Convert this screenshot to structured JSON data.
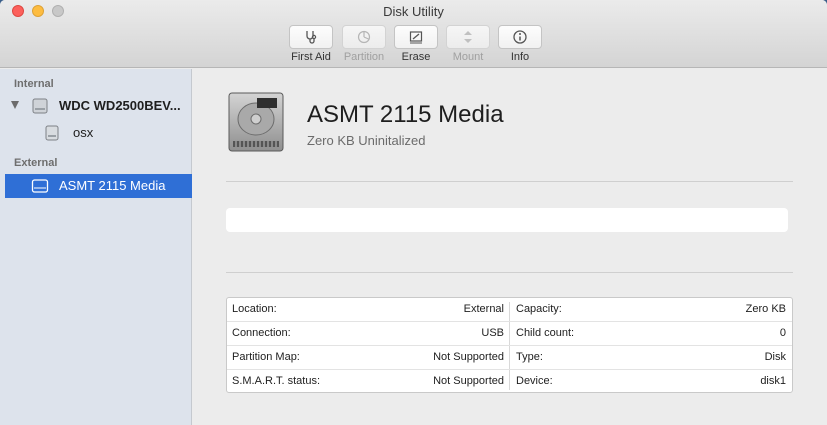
{
  "window": {
    "title": "Disk Utility"
  },
  "toolbar": {
    "items": [
      {
        "label": "First Aid",
        "icon": "stethoscope-icon",
        "enabled": true
      },
      {
        "label": "Partition",
        "icon": "pie-chart-icon",
        "enabled": false
      },
      {
        "label": "Erase",
        "icon": "eraser-icon",
        "enabled": true
      },
      {
        "label": "Mount",
        "icon": "mount-icon",
        "enabled": false
      },
      {
        "label": "Info",
        "icon": "info-icon",
        "enabled": true
      }
    ]
  },
  "sidebar": {
    "sections": [
      {
        "title": "Internal",
        "items": [
          {
            "label": "WDC WD2500BEV...",
            "icon": "hard-drive-icon",
            "expanded": true
          },
          {
            "label": "osx",
            "icon": "volume-icon"
          }
        ]
      },
      {
        "title": "External",
        "items": [
          {
            "label": "ASMT 2115 Media",
            "icon": "external-drive-icon",
            "selected": true
          }
        ]
      }
    ]
  },
  "volume": {
    "name": "ASMT 2115 Media",
    "subtitle": "Zero KB Uninitalized"
  },
  "info": {
    "left": [
      {
        "label": "Location:",
        "value": "External"
      },
      {
        "label": "Connection:",
        "value": "USB"
      },
      {
        "label": "Partition Map:",
        "value": "Not Supported"
      },
      {
        "label": "S.M.A.R.T. status:",
        "value": "Not Supported"
      }
    ],
    "right": [
      {
        "label": "Capacity:",
        "value": "Zero KB"
      },
      {
        "label": "Child count:",
        "value": "0"
      },
      {
        "label": "Type:",
        "value": "Disk"
      },
      {
        "label": "Device:",
        "value": "disk1"
      }
    ]
  },
  "colors": {
    "selection": "#2f6fd6",
    "sidebar_bg": "#dde3ec",
    "close": "#fc605c",
    "minimize": "#fdbc40"
  }
}
